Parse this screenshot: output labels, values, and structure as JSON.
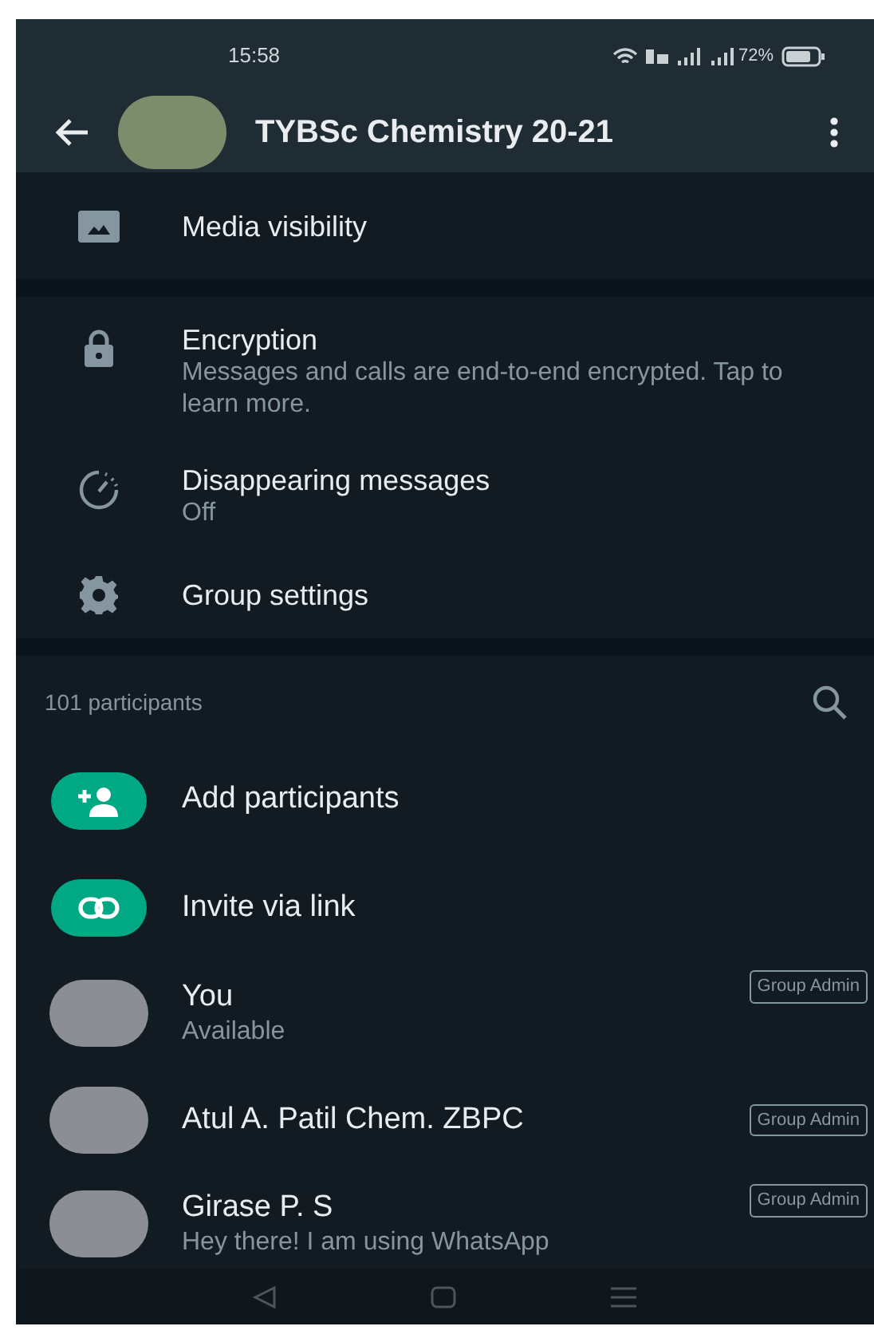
{
  "status_bar": {
    "time": "15:58",
    "battery": "72%"
  },
  "header": {
    "title": "TYBSc Chemistry 20-21"
  },
  "settings_groups": [
    [
      {
        "kind": "media",
        "label": "Media visibility"
      }
    ],
    [
      {
        "kind": "lock",
        "label": "Encryption",
        "subtitle": "Messages and calls are end-to-end encrypted. Tap to learn more."
      },
      {
        "kind": "timer",
        "label": "Disappearing messages",
        "subtitle": "Off"
      },
      {
        "kind": "gear",
        "label": "Group settings"
      }
    ]
  ],
  "participants": {
    "count_label": "101 participants",
    "actions": [
      {
        "kind": "add",
        "label": "Add participants"
      },
      {
        "kind": "link",
        "label": "Invite via link"
      }
    ],
    "members": [
      {
        "name": "You",
        "status": "Available",
        "badge": "Group Admin"
      },
      {
        "name": "Atul A. Patil Chem. ZBPC",
        "badge": "Group Admin"
      },
      {
        "name": "Girase P. S",
        "status": "Hey there! I am using WhatsApp",
        "badge": "Group Admin"
      }
    ]
  }
}
